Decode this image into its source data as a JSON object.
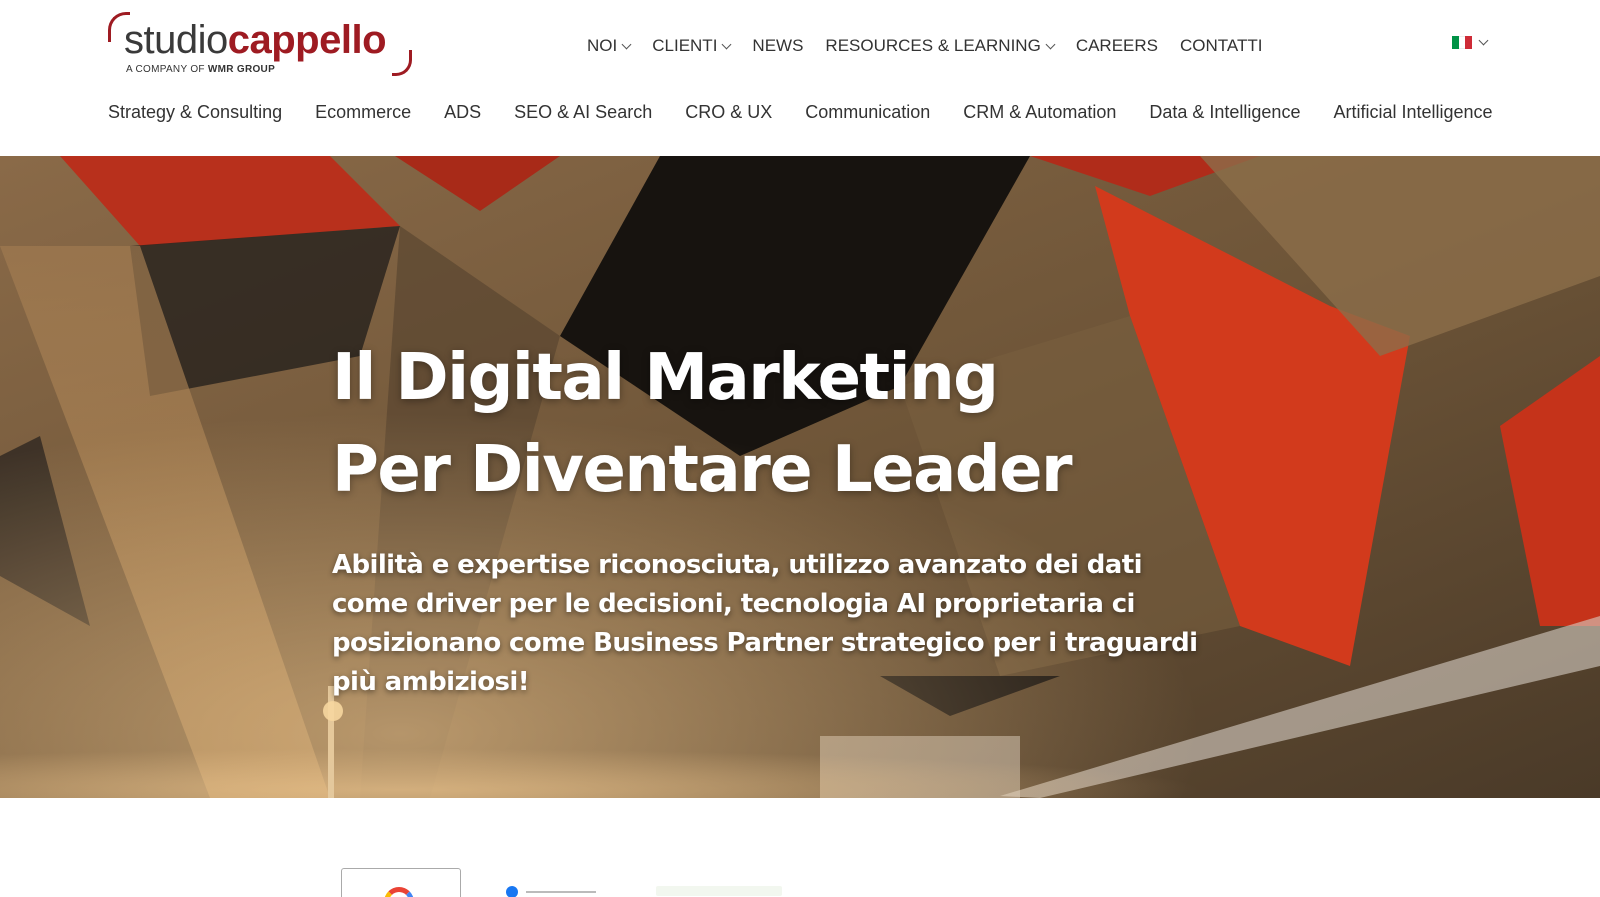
{
  "header": {
    "logo": {
      "brand_part1": "studio",
      "brand_part2": "cappello",
      "tagline_prefix": "A COMPANY OF",
      "tagline_brand": "WMR GROUP"
    },
    "topnav": [
      {
        "label": "NOI",
        "has_dropdown": true
      },
      {
        "label": "CLIENTI",
        "has_dropdown": true
      },
      {
        "label": "NEWS",
        "has_dropdown": false
      },
      {
        "label": "RESOURCES & LEARNING",
        "has_dropdown": true
      },
      {
        "label": "CAREERS",
        "has_dropdown": false
      },
      {
        "label": "CONTATTI",
        "has_dropdown": false
      }
    ],
    "language": {
      "icon": "italy-flag-icon",
      "colors": [
        "#009246",
        "#ffffff",
        "#ce2b37"
      ]
    },
    "subnav": [
      "Strategy & Consulting",
      "Ecommerce",
      "ADS",
      "SEO & AI Search",
      "CRO & UX",
      "Communication",
      "CRM & Automation",
      "Data & Intelligence",
      "Artificial Intelligence"
    ]
  },
  "hero": {
    "title_line1": "Il Digital Marketing",
    "title_line2": "Per Diventare Leader",
    "subtitle": "Abilità e expertise riconosciuta, utilizzo avanzato dei dati come driver per le decisioni, tecnologia AI proprietaria ci posizionano come Business Partner strategico per i traguardi più ambiziosi!"
  },
  "colors": {
    "brand_red": "#9e1b22",
    "text_dark": "#333333",
    "hero_red": "#c8321a"
  }
}
